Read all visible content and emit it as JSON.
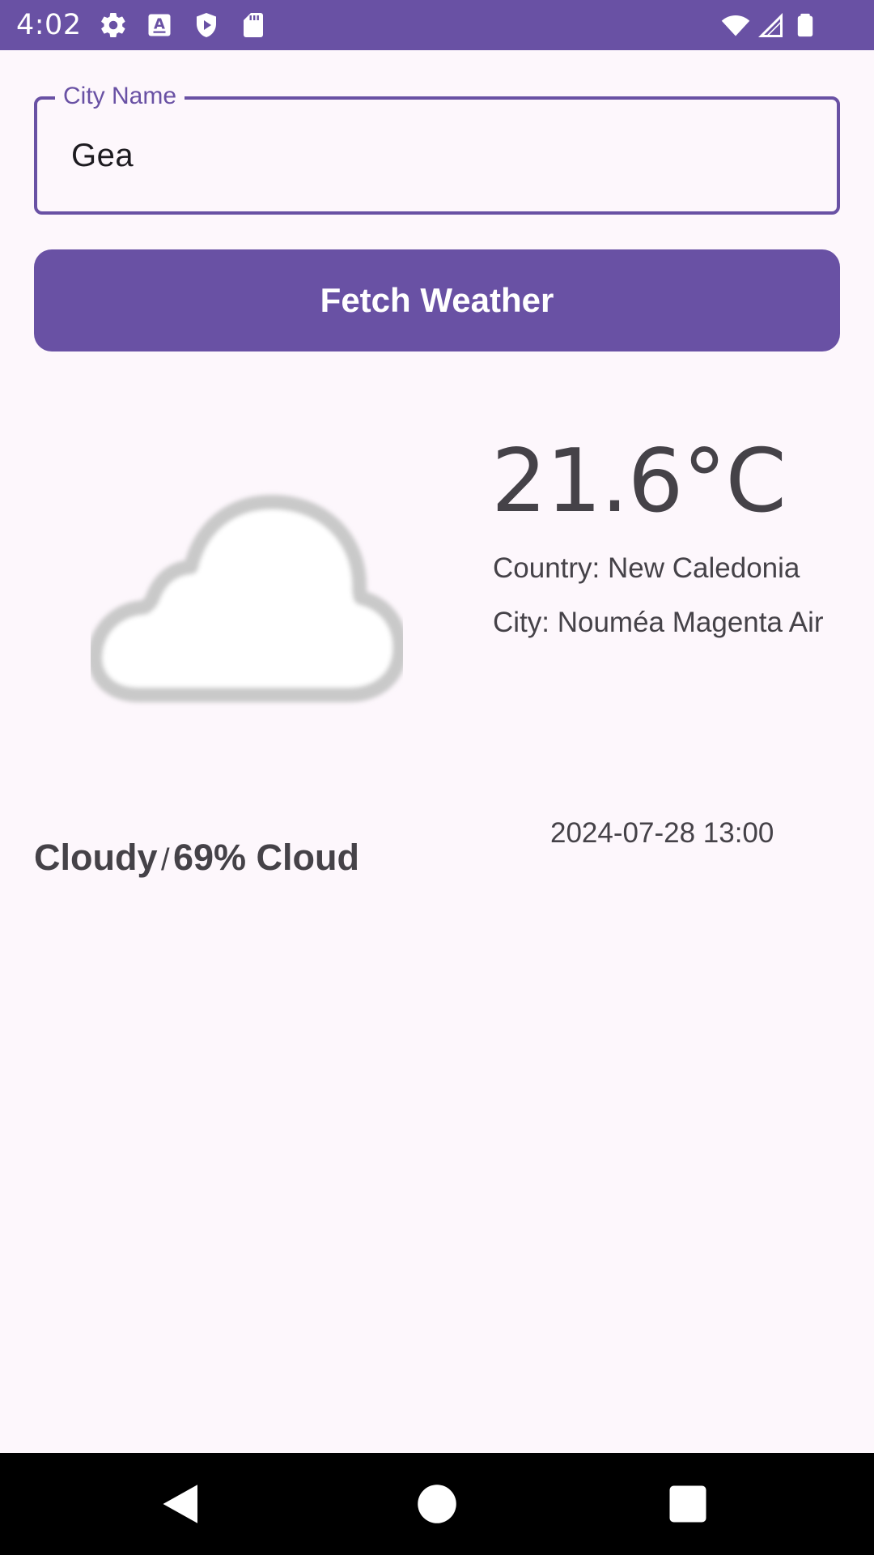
{
  "status_bar": {
    "time": "4:02",
    "icons": [
      "settings-icon",
      "text-a-icon",
      "shield-play-icon",
      "sd-card-icon",
      "wifi-icon",
      "signal-icon",
      "battery-icon"
    ],
    "background": "#6951a4"
  },
  "city_input": {
    "label": "City Name",
    "value": "Gea"
  },
  "fetch_button": {
    "label": "Fetch Weather"
  },
  "weather": {
    "icon": "cloud-icon",
    "temperature": "21.6°C",
    "country": "Country: New Caledonia",
    "city": "City: Nouméa Magenta Air",
    "condition": "Cloudy",
    "separator": "/",
    "cloud_cover": "69% Cloud",
    "datetime": "2024-07-28 13:00"
  },
  "nav_bar": {
    "buttons": [
      "back-icon",
      "home-icon",
      "recents-icon"
    ]
  },
  "colors": {
    "primary": "#6951a4",
    "background": "#fdf7fc",
    "text": "#454248"
  }
}
